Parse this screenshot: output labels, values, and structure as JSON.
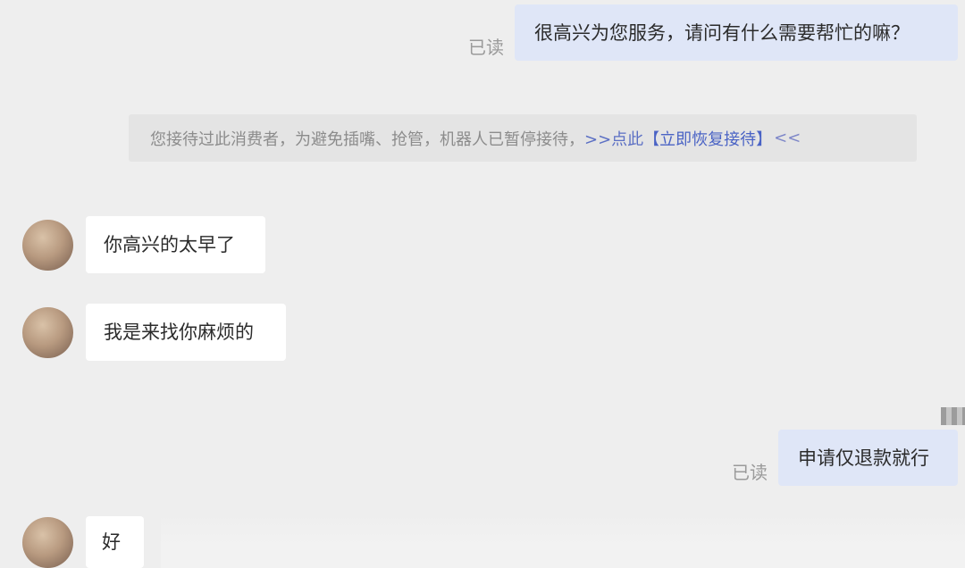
{
  "messages": [
    {
      "id": "m1",
      "direction": "out",
      "text": "很高兴为您服务，请问有什么需要帮忙的嘛？",
      "status": "已读"
    },
    {
      "id": "m2",
      "direction": "system",
      "text": "您接待过此消费者，为避免插嘴、抢管，机器人已暂停接待，",
      "link_prefix": ">>点此",
      "action_open": "【",
      "action_label": "立即恢复接待",
      "action_close": "】",
      "link_suffix": "<<"
    },
    {
      "id": "m3",
      "direction": "in",
      "text": "你高兴的太早了"
    },
    {
      "id": "m4",
      "direction": "in",
      "text": "我是来找你麻烦的"
    },
    {
      "id": "m5",
      "direction": "out",
      "text": "申请仅退款就行",
      "status": "已读"
    },
    {
      "id": "m6",
      "direction": "in",
      "text": "好"
    }
  ],
  "colors": {
    "background": "#eeeeee",
    "outgoing_bubble": "#dfe6f7",
    "incoming_bubble": "#ffffff",
    "system_bg": "#e4e4e4",
    "link": "#4a63c5"
  }
}
